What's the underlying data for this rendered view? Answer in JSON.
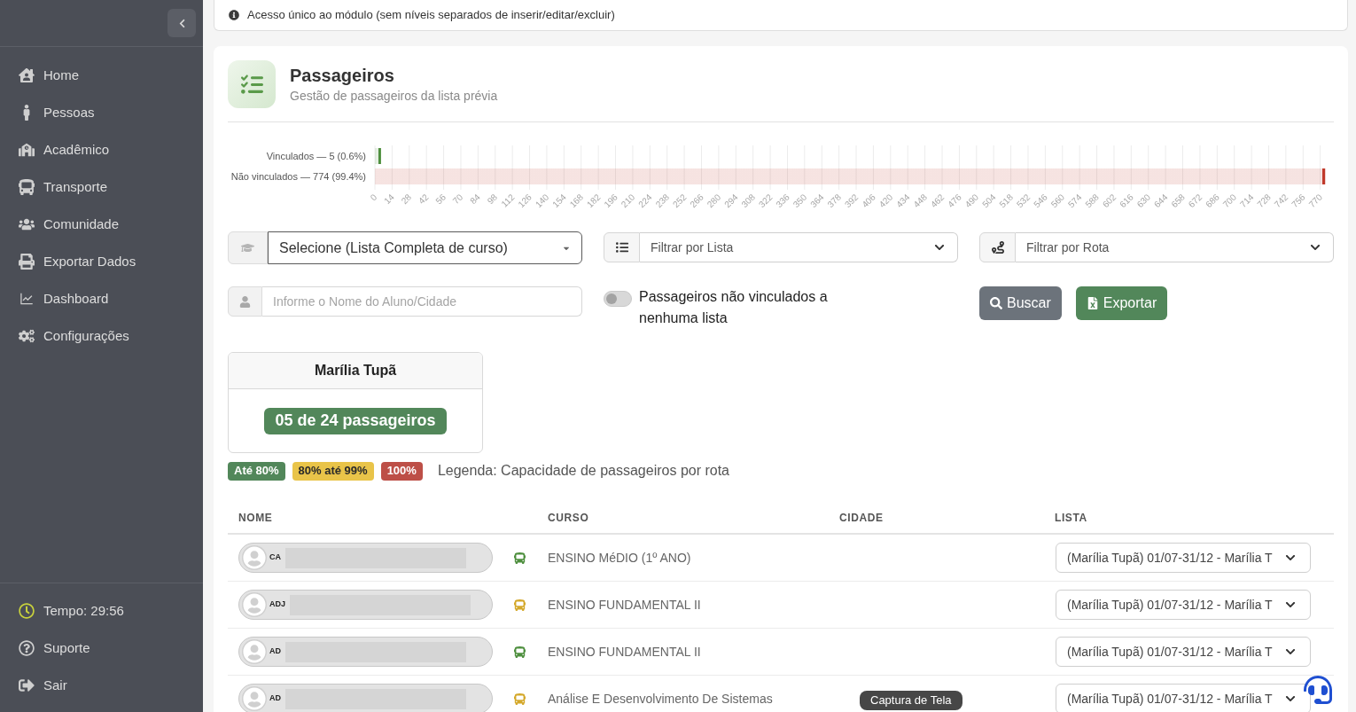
{
  "sidebar": {
    "items": [
      {
        "label": "Home"
      },
      {
        "label": "Pessoas"
      },
      {
        "label": "Acadêmico"
      },
      {
        "label": "Transporte"
      },
      {
        "label": "Comunidade"
      },
      {
        "label": "Exportar Dados"
      },
      {
        "label": "Dashboard"
      },
      {
        "label": "Configurações"
      }
    ],
    "footer_items": [
      {
        "label": "Tempo: 29:56",
        "kind": "timer"
      },
      {
        "label": "Suporte",
        "kind": "link"
      },
      {
        "label": "Sair",
        "kind": "link"
      }
    ]
  },
  "notice": "Acesso único ao módulo (sem níveis separados de inserir/editar/excluir)",
  "page": {
    "title": "Passageiros",
    "subtitle": "Gestão de passageiros da lista prévia",
    "chart_data": {
      "type": "bar",
      "orientation": "horizontal",
      "grid": true,
      "categories": [
        "Vinculados — 5 (0.6%)",
        "Não vinculados — 774 (99.4%)"
      ],
      "series": [
        {
          "values": [
            5,
            774
          ]
        }
      ],
      "colors": [
        "#4e8f3e",
        "#c0392b"
      ],
      "xlim": [
        0,
        776
      ],
      "xticks": [
        0,
        14,
        28,
        42,
        56,
        70,
        84,
        98,
        112,
        126,
        140,
        154,
        168,
        182,
        196,
        210,
        224,
        238,
        252,
        266,
        280,
        294,
        308,
        322,
        336,
        350,
        364,
        378,
        392,
        406,
        420,
        434,
        448,
        462,
        476,
        490,
        504,
        518,
        532,
        546,
        560,
        574,
        588,
        602,
        616,
        630,
        644,
        658,
        672,
        686,
        700,
        714,
        728,
        742,
        756,
        770
      ]
    }
  },
  "filters": {
    "course": {
      "value": "Selecione (Lista Completa de curso)"
    },
    "list": {
      "value": "Filtrar por Lista"
    },
    "route": {
      "value": "Filtrar por Rota"
    },
    "search": {
      "placeholder": "Informe o Nome do Aluno/Cidade"
    },
    "unlinked_only": {
      "label": "Passageiros não vinculados a nenhuma lista",
      "on": false
    }
  },
  "buttons": [
    {
      "label": "Buscar",
      "kind": "search"
    },
    {
      "label": "Exportar",
      "kind": "export"
    }
  ],
  "route_cards": [
    {
      "title": "Marília Tupã",
      "count": "05 de 24 passageiros",
      "color": "#52875a"
    }
  ],
  "legend": {
    "items": [
      {
        "label": "Até 80%",
        "color": "#52875a"
      },
      {
        "label": "80% até 99%",
        "color": "#e9c449"
      },
      {
        "label": "100%",
        "color": "#bd4f47"
      }
    ],
    "caption": "Legenda: Capacidade de passageiros por rota"
  },
  "table": {
    "columns": [
      "NOME",
      "CURSO",
      "CIDADE",
      "LISTA"
    ],
    "rows": [
      {
        "name": "CA",
        "color": "#4e8f3e",
        "course": "ENSINO MéDIO (1º ANO)",
        "list": "(Marília Tupã) 01/07-31/12 - Marília T"
      },
      {
        "name": "ADJ",
        "color": "#d4a82a",
        "course": "ENSINO FUNDAMENTAL II",
        "list": "(Marília Tupã) 01/07-31/12 - Marília T"
      },
      {
        "name": "AD",
        "color": "#4e8f3e",
        "course": "ENSINO FUNDAMENTAL II",
        "list": "(Marília Tupã) 01/07-31/12 - Marília T"
      },
      {
        "name": "AD",
        "color": "#d4a82a",
        "course": "Análise E Desenvolvimento De Sistemas",
        "list": "(Marília Tupã) 01/07-31/12 - Marília T"
      }
    ]
  },
  "screenshot_tooltip": "Captura de Tela"
}
